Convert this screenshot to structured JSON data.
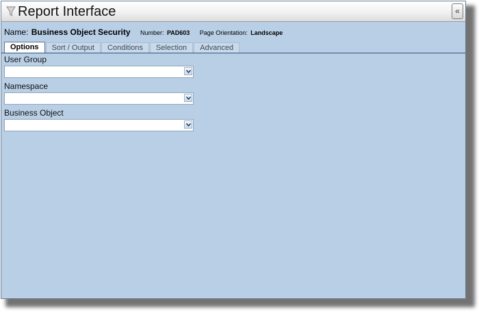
{
  "window": {
    "title": "Report Interface",
    "collapse_glyph": "«"
  },
  "report": {
    "name_label": "Name:",
    "name_value": "Business Object Security",
    "number_label": "Number:",
    "number_value": "PAD603",
    "orientation_label": "Page Orientation:",
    "orientation_value": "Landscape"
  },
  "tabs": [
    {
      "label": "Options",
      "active": true
    },
    {
      "label": "Sort / Output",
      "active": false
    },
    {
      "label": "Conditions",
      "active": false
    },
    {
      "label": "Selection",
      "active": false
    },
    {
      "label": "Advanced",
      "active": false
    }
  ],
  "fields": [
    {
      "label": "User Group",
      "value": ""
    },
    {
      "label": "Namespace",
      "value": ""
    },
    {
      "label": "Business Object",
      "value": ""
    }
  ],
  "icons": {
    "title": "funnel-icon",
    "collapse": "double-chevron-left-icon",
    "dropdown": "chevron-down-icon"
  },
  "colors": {
    "panel_background": "#b9cfe6",
    "tab_rule": "#2a4f7d",
    "active_tab": "#ffffff"
  }
}
